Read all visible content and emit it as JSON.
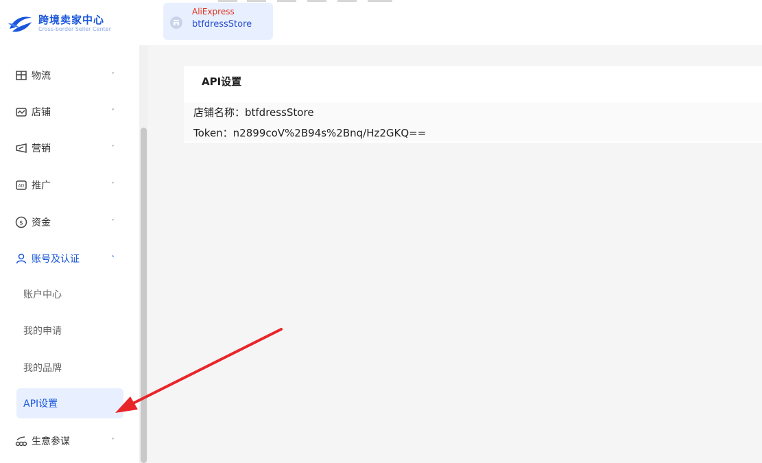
{
  "header": {
    "brand_name": "跨境卖家中心",
    "brand_sub": "Cross-border Seller Center",
    "store_platform": "AliExpress",
    "store_name": "btfdressStore"
  },
  "sidebar": {
    "items": [
      {
        "label": "物流",
        "icon": "logistics-icon",
        "chevron": "˅"
      },
      {
        "label": "店铺",
        "icon": "store-icon",
        "chevron": "˅"
      },
      {
        "label": "营销",
        "icon": "marketing-icon",
        "chevron": "˅"
      },
      {
        "label": "推广",
        "icon": "ad-icon",
        "chevron": "˅"
      },
      {
        "label": "资金",
        "icon": "dollar-icon",
        "chevron": "˅"
      },
      {
        "label": "账号及认证",
        "icon": "user-icon",
        "chevron": "˄"
      },
      {
        "label": "生意参谋",
        "icon": "chart-icon",
        "chevron": "˅"
      }
    ],
    "sub_items": [
      {
        "label": "账户中心"
      },
      {
        "label": "我的申请"
      },
      {
        "label": "我的品牌"
      },
      {
        "label": "API设置"
      }
    ]
  },
  "main": {
    "title": "API设置",
    "store_line": "店铺名称：btfdressStore",
    "token_line": "Token：n2899coV%2B94s%2Bnq/Hz2GKQ=="
  },
  "colors": {
    "accent": "#1a56db",
    "annotation": "#e8262a",
    "platform": "#e0301e"
  }
}
